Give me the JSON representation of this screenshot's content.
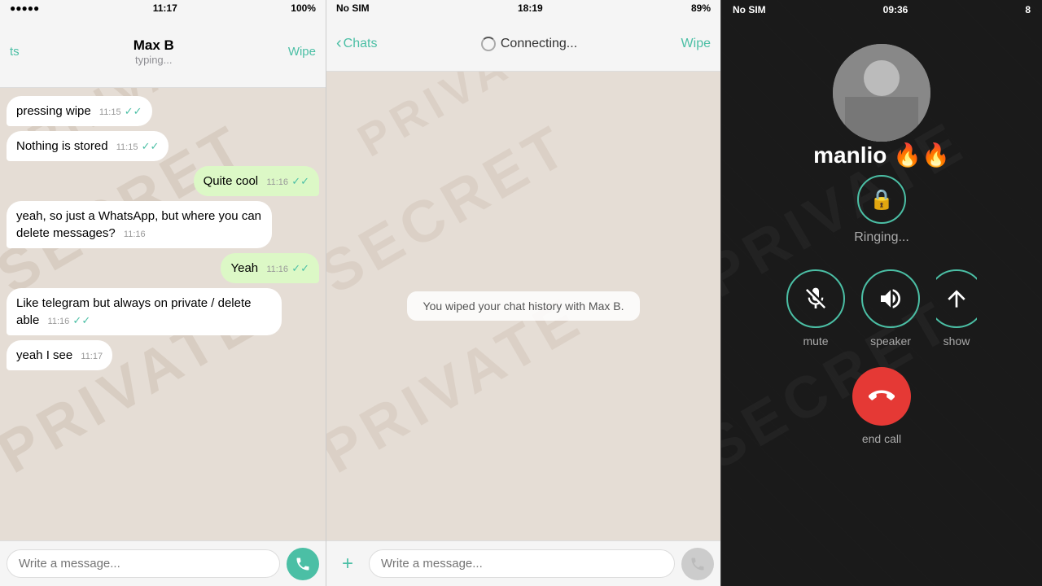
{
  "panel1": {
    "status_bar": {
      "time": "11:17",
      "battery": "100%",
      "signal": "●●●●●"
    },
    "header": {
      "back_label": "ts",
      "contact_name": "Max B",
      "status": "typing...",
      "wipe_label": "Wipe"
    },
    "messages": [
      {
        "id": 1,
        "type": "received",
        "text": "pressing wipe",
        "time": "11:15",
        "ticks": "✓✓"
      },
      {
        "id": 2,
        "type": "received",
        "text": "Nothing is stored",
        "time": "11:15",
        "ticks": "✓✓"
      },
      {
        "id": 3,
        "type": "sent",
        "text": "Quite cool",
        "time": "11:16",
        "ticks": "✓✓"
      },
      {
        "id": 4,
        "type": "received",
        "text": "yeah, so just a WhatsApp, but where you can delete messages?",
        "time": "11:16",
        "ticks": ""
      },
      {
        "id": 5,
        "type": "sent",
        "text": "Yeah",
        "time": "11:16",
        "ticks": "✓✓"
      },
      {
        "id": 6,
        "type": "received",
        "text": "Like telegram but always on private / delete able",
        "time": "11:16",
        "ticks": "✓✓"
      },
      {
        "id": 7,
        "type": "received",
        "text": "yeah I see",
        "time": "11:17",
        "ticks": ""
      }
    ],
    "input": {
      "placeholder": "Write a message..."
    }
  },
  "panel2": {
    "status_bar": {
      "time": "18:19",
      "no_sim": "No SIM",
      "battery": "89%"
    },
    "header": {
      "back_label": "Chats",
      "connecting_text": "Connecting...",
      "wipe_label": "Wipe"
    },
    "wiped_notice": "You wiped your chat history with Max B.",
    "input": {
      "placeholder": "Write a message..."
    }
  },
  "panel3": {
    "status_bar": {
      "no_sim": "No SIM",
      "time": "09:36",
      "battery": "8"
    },
    "caller_name": "manlio 🔥🔥",
    "caller_name_text": "manlio",
    "lock_status": "Ringing...",
    "controls": {
      "mute_label": "mute",
      "speaker_label": "speaker",
      "show_label": "show"
    },
    "end_call_label": "end call"
  }
}
